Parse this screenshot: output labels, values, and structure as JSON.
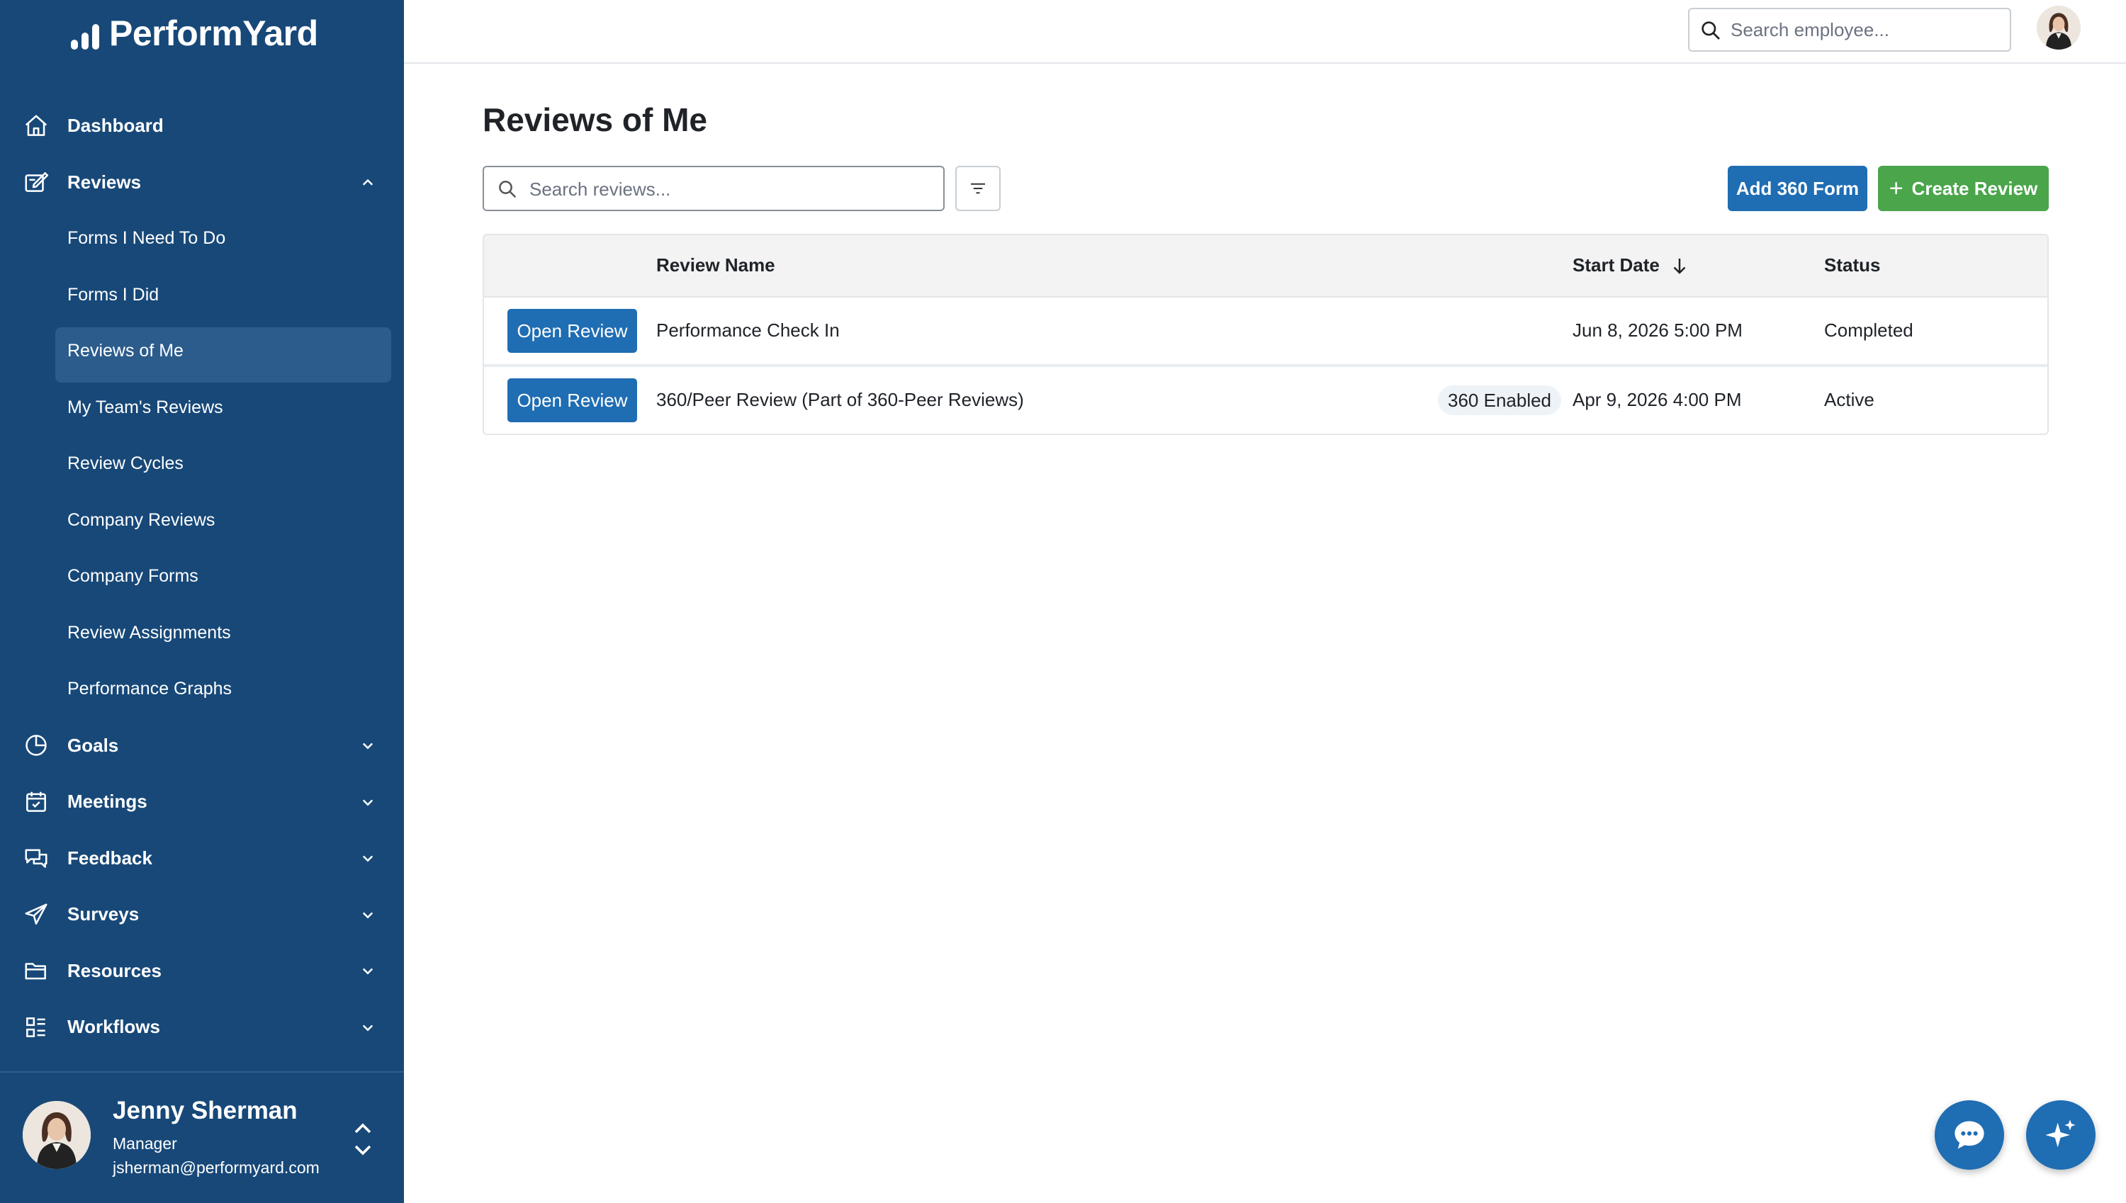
{
  "app": {
    "brand": "PerformYard"
  },
  "sidebar": {
    "items": [
      {
        "label": "Dashboard",
        "icon": "home-icon"
      },
      {
        "label": "Reviews",
        "icon": "reviews-icon",
        "expanded": true,
        "children": [
          "Forms I Need To Do",
          "Forms I Did",
          "Reviews of Me",
          "My Team's Reviews",
          "Review Cycles",
          "Company Reviews",
          "Company Forms",
          "Review Assignments",
          "Performance Graphs"
        ],
        "active_child": "Reviews of Me"
      },
      {
        "label": "Goals",
        "icon": "goals-icon"
      },
      {
        "label": "Meetings",
        "icon": "calendar-icon"
      },
      {
        "label": "Feedback",
        "icon": "feedback-icon"
      },
      {
        "label": "Surveys",
        "icon": "send-icon"
      },
      {
        "label": "Resources",
        "icon": "folder-icon"
      },
      {
        "label": "Workflows",
        "icon": "workflows-icon"
      }
    ],
    "user": {
      "name": "Jenny Sherman",
      "role": "Manager",
      "email": "jsherman@performyard.com"
    }
  },
  "topbar": {
    "search_placeholder": "Search employee..."
  },
  "main": {
    "title": "Reviews of Me",
    "search_placeholder": "Search reviews...",
    "add_360_label": "Add 360 Form",
    "create_review_label": "Create Review",
    "table": {
      "columns": [
        "Review Name",
        "Start Date",
        "Status"
      ],
      "sort_column": "Start Date",
      "sort_direction": "descending",
      "rows": [
        {
          "action": "Open Review",
          "name": "Performance Check In",
          "badge": "",
          "start_date": "Jun 8, 2026 5:00 PM",
          "status": "Completed"
        },
        {
          "action": "Open Review",
          "name": "360/Peer Review (Part of 360-Peer Reviews)",
          "badge": "360 Enabled",
          "start_date": "Apr 9, 2026 4:00 PM",
          "status": "Active"
        }
      ]
    }
  },
  "colors": {
    "sidebar_bg": "#174878",
    "primary": "#1f6db3",
    "success": "#4aa54b"
  }
}
